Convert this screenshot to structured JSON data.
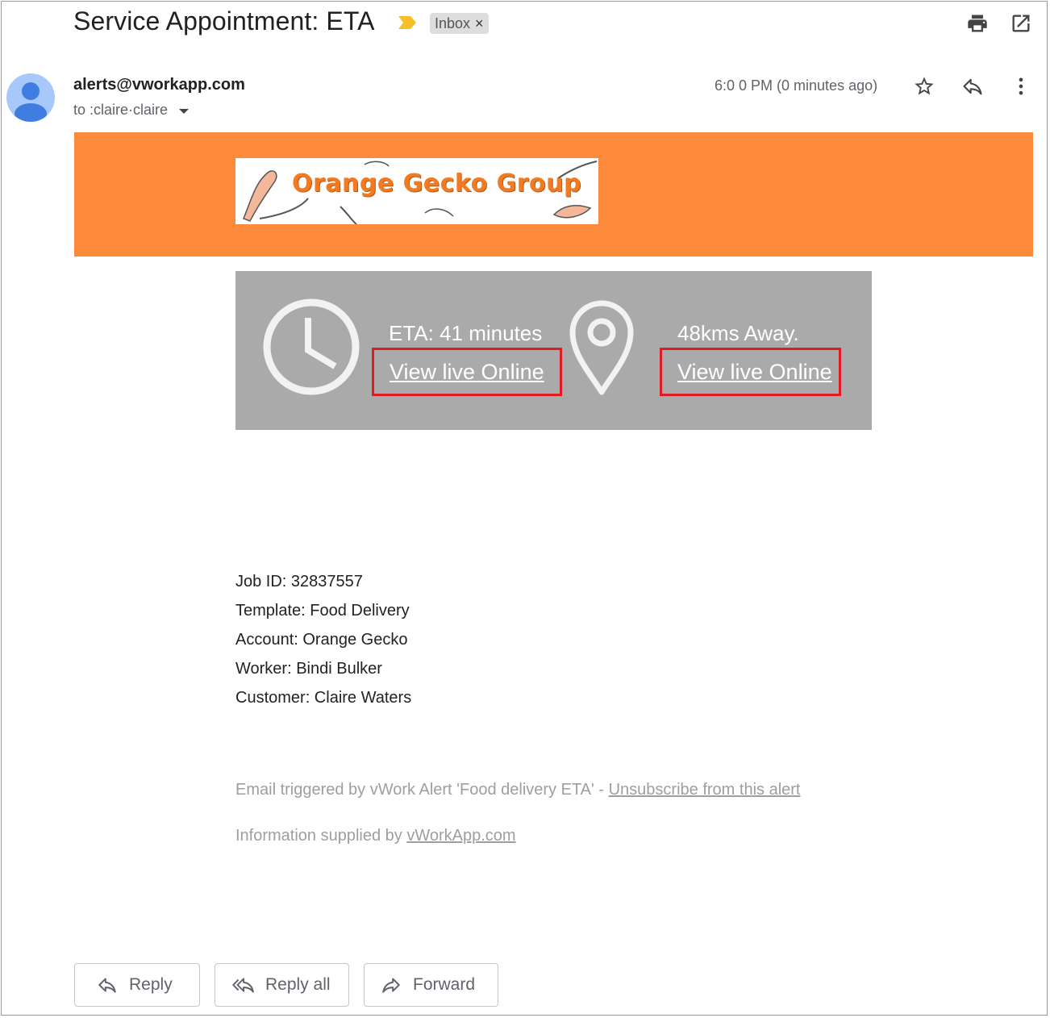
{
  "email": {
    "subject": "Service Appointment: ETA",
    "label": "Inbox",
    "label_remove": "×",
    "sender": "alerts@vworkapp.com",
    "recipient": "to :claire·claire",
    "time": "6:0 0 PM (0 minutes ago)"
  },
  "banner": {
    "color": "#fd8a3a",
    "logo_text": "Orange Gecko Group"
  },
  "eta_panel": {
    "eta_text": "ETA: 41 minutes",
    "eta_link": "View live Online",
    "distance_text": "48kms Away.",
    "distance_link": "View live Online",
    "highlight_color": "#e01b24"
  },
  "details": [
    "Job ID: 32837557",
    "Template: Food Delivery",
    "Account: Orange Gecko",
    "Worker: Bindi Bulker",
    "Customer: Claire Waters"
  ],
  "footer": {
    "trigger_text": "Email triggered by vWork Alert 'Food delivery ETA' - ",
    "unsubscribe_link": "Unsubscribe from this alert",
    "supplied_text": "Information supplied by ",
    "supplied_link": "vWorkApp.com"
  },
  "actions": {
    "reply": "Reply",
    "reply_all": "Reply all",
    "forward": "Forward"
  },
  "icons": [
    "importance-marker-icon",
    "print-icon",
    "open-in-new-window-icon",
    "avatar-icon",
    "star-icon",
    "reply-icon",
    "more-vert-icon",
    "clock-icon",
    "location-pin-icon",
    "reply-all-icon",
    "forward-icon"
  ]
}
